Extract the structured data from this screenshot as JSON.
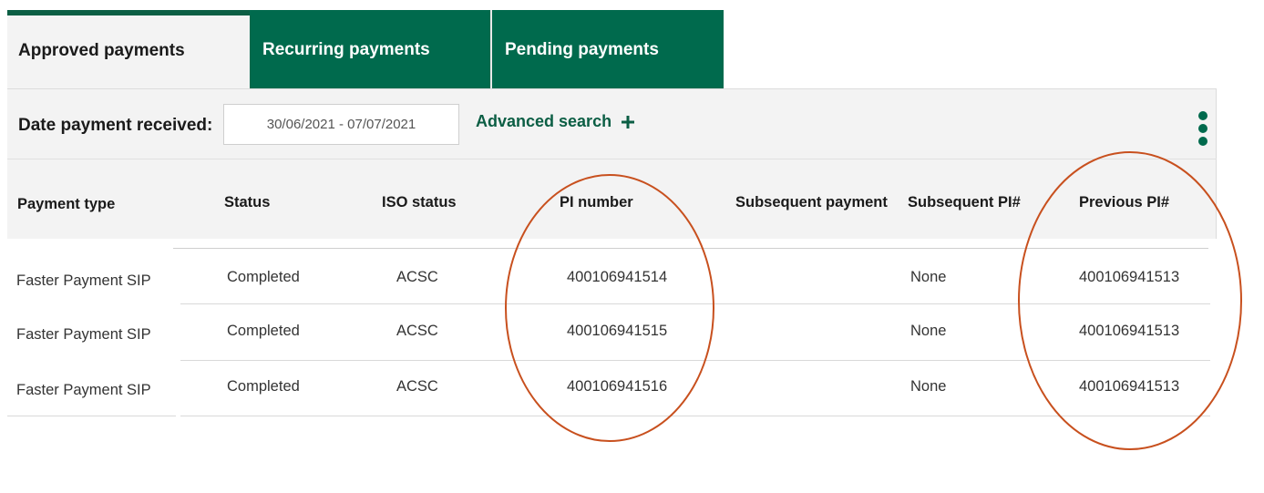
{
  "tabs": [
    {
      "label": "Approved payments",
      "active": true
    },
    {
      "label": "Recurring payments",
      "active": false
    },
    {
      "label": "Pending payments",
      "active": false
    }
  ],
  "filter": {
    "date_label": "Date payment received:",
    "date_value": "30/06/2021 - 07/07/2021",
    "advanced_search_label": "Advanced search",
    "more_options_icon": "more-vertical-icon"
  },
  "table": {
    "columns": [
      "Payment type",
      "Status",
      "ISO status",
      "PI number",
      "Subsequent payment",
      "Subsequent PI#",
      "Previous PI#"
    ],
    "rows": [
      [
        "Faster Payment SIP",
        "Completed",
        "ACSC",
        "400106941514",
        "",
        "None",
        "400106941513"
      ],
      [
        "Faster Payment SIP",
        "Completed",
        "ACSC",
        "400106941515",
        "",
        "None",
        "400106941513"
      ],
      [
        "Faster Payment SIP",
        "Completed",
        "ACSC",
        "400106941516",
        "",
        "None",
        "400106941513"
      ]
    ]
  },
  "colors": {
    "brand_green": "#006a4d",
    "dark_green_text": "#0b5e44",
    "annotation_red": "#c8501e",
    "band_grey": "#f3f3f3"
  }
}
